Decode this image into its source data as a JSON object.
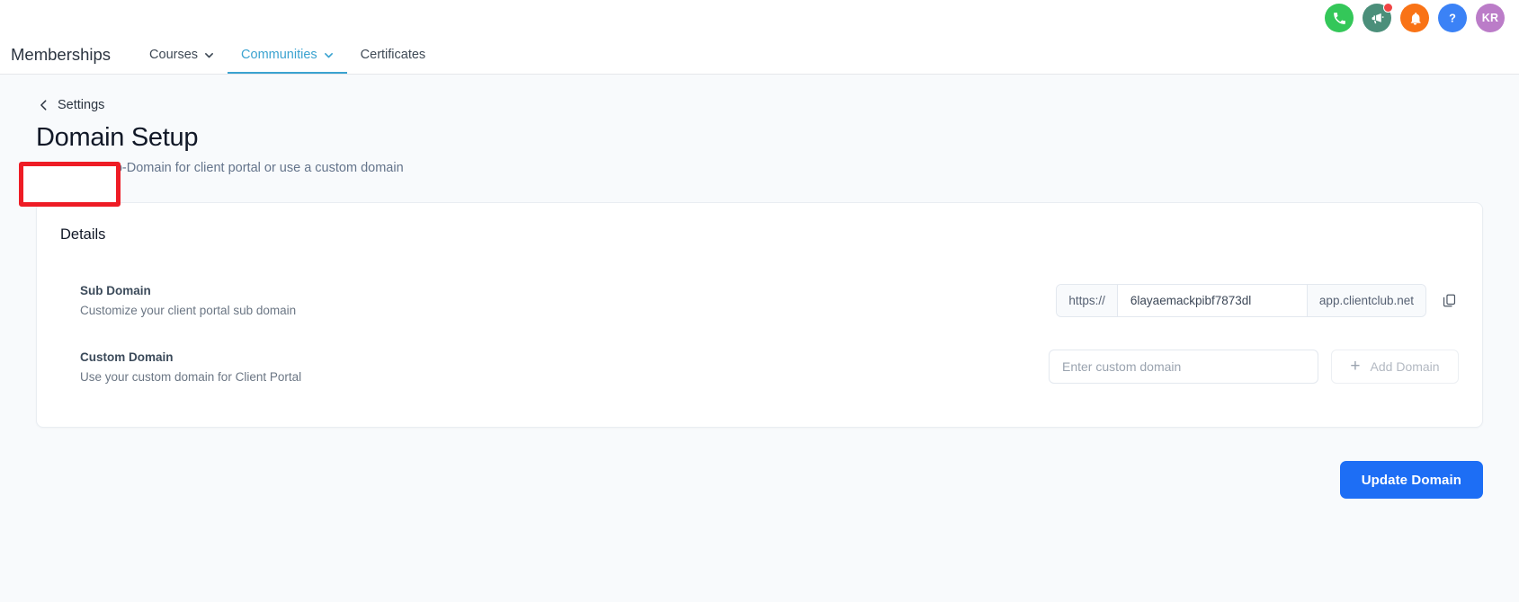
{
  "topbar": {
    "icons": [
      {
        "name": "phone-icon",
        "color": "#34c759",
        "label": "Phone"
      },
      {
        "name": "megaphone-icon",
        "color": "#4b8f7a",
        "label": "Announcements",
        "badge": true
      },
      {
        "name": "bell-icon",
        "color": "#f97316",
        "label": "Notifications"
      },
      {
        "name": "help-icon",
        "color": "#3b82f6",
        "label": "Help"
      }
    ],
    "avatar": {
      "initials": "KR",
      "color": "#bb7cc8"
    }
  },
  "nav": {
    "brand": "Memberships",
    "items": [
      {
        "label": "Courses",
        "has_caret": true,
        "active": false
      },
      {
        "label": "Communities",
        "has_caret": true,
        "active": true
      },
      {
        "label": "Certificates",
        "has_caret": false,
        "active": false
      }
    ],
    "active_color": "#3ba3d0"
  },
  "page": {
    "back_label": "Settings",
    "title": "Domain Setup",
    "subtitle": "Set up the Sub-Domain for client portal or use a custom domain",
    "highlight_color": "#ee1c25"
  },
  "card": {
    "title": "Details",
    "rows": [
      {
        "label": "Sub Domain",
        "desc": "Customize your client portal sub domain",
        "prefix": "https://",
        "value": "6layaemackpibf7873dl",
        "suffix": "app.clientclub.net",
        "copy_icon": "copy-icon"
      },
      {
        "label": "Custom Domain",
        "desc": "Use your custom domain for Client Portal",
        "placeholder": "Enter custom domain",
        "value": "",
        "button_label": "Add Domain"
      }
    ]
  },
  "footer": {
    "primary_label": "Update Domain",
    "primary_color": "#1d6ef5"
  }
}
